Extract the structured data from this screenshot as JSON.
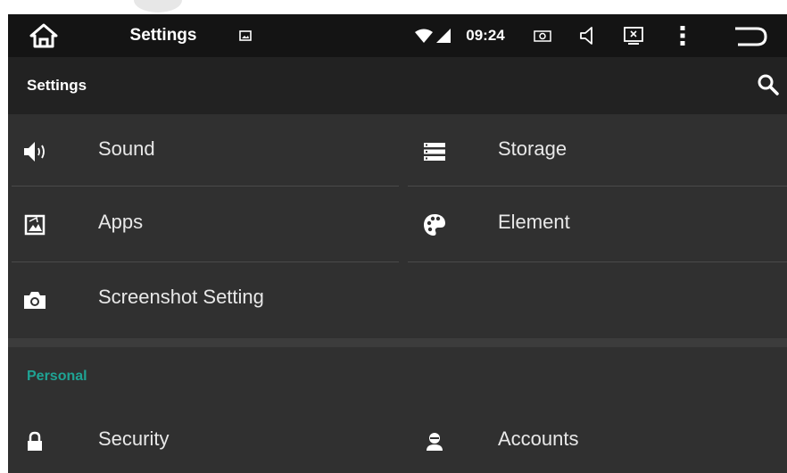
{
  "status_bar": {
    "title": "Settings",
    "time": "09:24"
  },
  "action_bar": {
    "title": "Settings"
  },
  "device_items": [
    {
      "label": "Sound",
      "icon": "speaker-icon"
    },
    {
      "label": "Storage",
      "icon": "storage-icon"
    },
    {
      "label": "Apps",
      "icon": "apps-icon"
    },
    {
      "label": "Element",
      "icon": "palette-icon"
    },
    {
      "label": "Screenshot Setting",
      "icon": "camera-icon"
    }
  ],
  "personal": {
    "header": "Personal",
    "items": [
      {
        "label": "Security",
        "icon": "lock-icon"
      },
      {
        "label": "Accounts",
        "icon": "account-icon"
      }
    ]
  },
  "colors": {
    "status_bar_bg": "#141414",
    "action_bar_bg": "#222222",
    "content_bg": "#303030",
    "accent": "#1fa394"
  }
}
